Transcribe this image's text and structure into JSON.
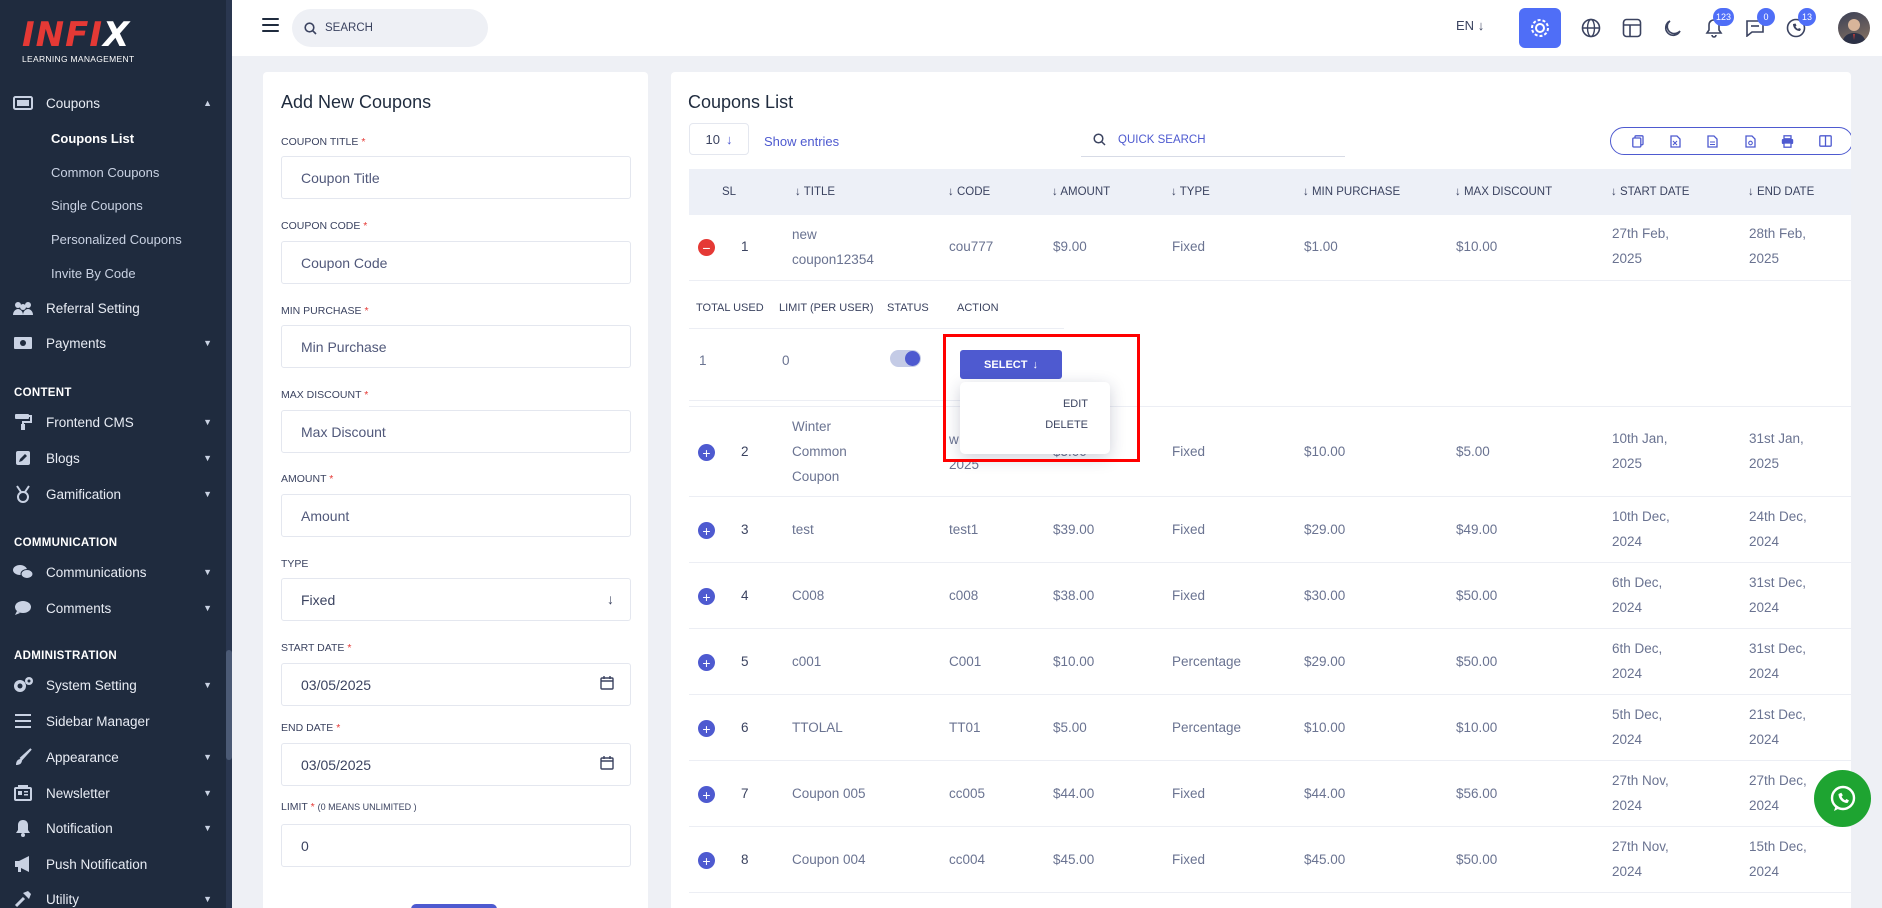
{
  "brand": {
    "logo_main_red": "INFI",
    "logo_main_white": "X",
    "logo_sub": "LEARNING MANAGEMENT"
  },
  "sidebar": {
    "coupons": "Coupons",
    "coupon_sub": [
      "Coupons List",
      "Common Coupons",
      "Single Coupons",
      "Personalized Coupons",
      "Invite By Code"
    ],
    "referral": "Referral Setting",
    "payments": "Payments",
    "section_content": "CONTENT",
    "frontend_cms": "Frontend CMS",
    "blogs": "Blogs",
    "gamification": "Gamification",
    "section_communication": "COMMUNICATION",
    "communications": "Communications",
    "comments": "Comments",
    "section_administration": "ADMINISTRATION",
    "system_setting": "System Setting",
    "sidebar_manager": "Sidebar Manager",
    "appearance": "Appearance",
    "newsletter": "Newsletter",
    "notification": "Notification",
    "push_notification": "Push Notification",
    "utility": "Utility"
  },
  "header": {
    "search_placeholder": "SEARCH",
    "language": "EN",
    "badges": {
      "notifications": "123",
      "messages": "0",
      "calls": "13"
    }
  },
  "form": {
    "title": "Add New Coupons",
    "coupon_title_label": "COUPON TITLE",
    "coupon_title_ph": "Coupon Title",
    "coupon_code_label": "COUPON CODE",
    "coupon_code_ph": "Coupon Code",
    "min_purchase_label": "MIN PURCHASE",
    "min_purchase_ph": "Min Purchase",
    "max_discount_label": "MAX DISCOUNT",
    "max_discount_ph": "Max Discount",
    "amount_label": "AMOUNT",
    "amount_ph": "Amount",
    "type_label": "TYPE",
    "type_value": "Fixed",
    "start_date_label": "START DATE",
    "start_date_value": "03/05/2025",
    "end_date_label": "END DATE",
    "end_date_value": "03/05/2025",
    "limit_label": "LIMIT",
    "limit_note": "(0 MEANS UNLIMITED )",
    "limit_value": "0",
    "required_mark": "*"
  },
  "list": {
    "title": "Coupons List",
    "entries_value": "10",
    "entries_label": "Show entries",
    "quick_search_ph": "QUICK SEARCH",
    "columns": {
      "sl": "SL",
      "title": "TITLE",
      "code": "CODE",
      "amount": "AMOUNT",
      "type": "TYPE",
      "min_purchase": "MIN PURCHASE",
      "max_discount": "MAX DISCOUNT",
      "start_date": "START DATE",
      "end_date": "END DATE"
    },
    "rows": [
      {
        "sl": "1",
        "title": [
          "new",
          "coupon12354"
        ],
        "code": "cou777",
        "amount": "$9.00",
        "type": "Fixed",
        "min": "$1.00",
        "max": "$10.00",
        "start": [
          "27th Feb,",
          "2025"
        ],
        "end": [
          "28th Feb,",
          "2025"
        ]
      },
      {
        "sl": "2",
        "title": [
          "Winter",
          "Common",
          "Coupon"
        ],
        "code": [
          "w",
          "2025"
        ],
        "amount": "$5.00",
        "type": "Fixed",
        "min": "$10.00",
        "max": "$5.00",
        "start": [
          "10th Jan,",
          "2025"
        ],
        "end": [
          "31st Jan,",
          "2025"
        ]
      },
      {
        "sl": "3",
        "title": [
          "test"
        ],
        "code": "test1",
        "amount": "$39.00",
        "type": "Fixed",
        "min": "$29.00",
        "max": "$49.00",
        "start": [
          "10th Dec,",
          "2024"
        ],
        "end": [
          "24th Dec,",
          "2024"
        ]
      },
      {
        "sl": "4",
        "title": [
          "C008"
        ],
        "code": "c008",
        "amount": "$38.00",
        "type": "Fixed",
        "min": "$30.00",
        "max": "$50.00",
        "start": [
          "6th Dec,",
          "2024"
        ],
        "end": [
          "31st Dec,",
          "2024"
        ]
      },
      {
        "sl": "5",
        "title": [
          "c001"
        ],
        "code": "C001",
        "amount": "$10.00",
        "type": "Percentage",
        "min": "$29.00",
        "max": "$50.00",
        "start": [
          "6th Dec,",
          "2024"
        ],
        "end": [
          "31st Dec,",
          "2024"
        ]
      },
      {
        "sl": "6",
        "title": [
          "TTOLAL"
        ],
        "code": "TT01",
        "amount": "$5.00",
        "type": "Percentage",
        "min": "$10.00",
        "max": "$10.00",
        "start": [
          "5th Dec,",
          "2024"
        ],
        "end": [
          "21st Dec,",
          "2024"
        ]
      },
      {
        "sl": "7",
        "title": [
          "Coupon 005"
        ],
        "code": "cc005",
        "amount": "$44.00",
        "type": "Fixed",
        "min": "$44.00",
        "max": "$56.00",
        "start": [
          "27th Nov,",
          "2024"
        ],
        "end": [
          "27th Dec,",
          "2024"
        ]
      },
      {
        "sl": "8",
        "title": [
          "Coupon 004"
        ],
        "code": "cc004",
        "amount": "$45.00",
        "type": "Fixed",
        "min": "$45.00",
        "max": "$50.00",
        "start": [
          "27th Nov,",
          "2024"
        ],
        "end": [
          "15th Dec,",
          "2024"
        ]
      }
    ],
    "child": {
      "total_used_label": "TOTAL USED",
      "limit_label": "LIMIT (PER USER)",
      "status_label": "STATUS",
      "action_label": "ACTION",
      "total_used": "1",
      "limit": "0",
      "status_on": true,
      "select_label": "SELECT",
      "menu": [
        "EDIT",
        "DELETE"
      ]
    }
  },
  "colors": {
    "sidebar_bg": "#1f2b3e",
    "accent": "#4e5ad0",
    "danger": "#e53935",
    "whatsapp": "#1ea431",
    "highlight": "#ff0000"
  }
}
